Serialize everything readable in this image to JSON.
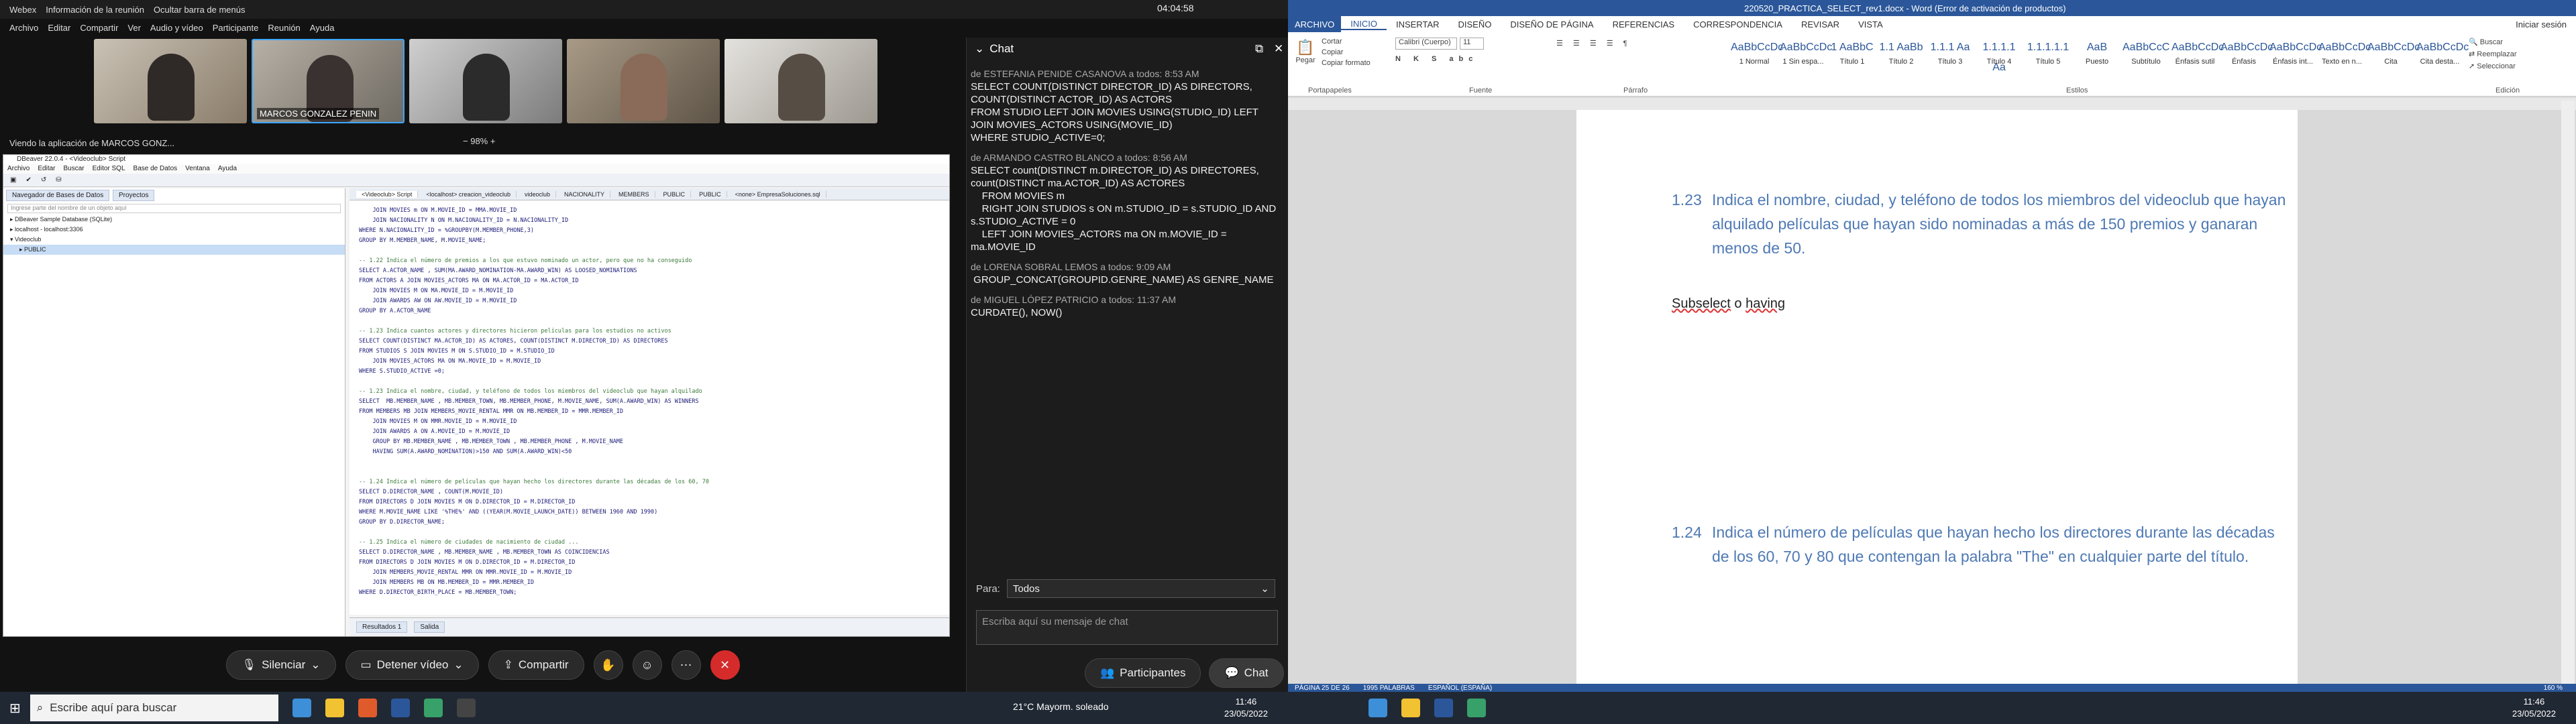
{
  "webex": {
    "app_name": "Webex",
    "meeting_info": "Información de la reunión",
    "hide_bar": "Ocultar barra de menús",
    "clock": "04:04:58",
    "menu": [
      "Archivo",
      "Editar",
      "Compartir",
      "Ver",
      "Audio y vídeo",
      "Participante",
      "Reunión",
      "Ayuda"
    ],
    "video_tiles": [
      {
        "name": ""
      },
      {
        "name": "MARCOS GONZALEZ PENIN"
      },
      {
        "name": ""
      },
      {
        "name": ""
      },
      {
        "name": ""
      }
    ],
    "viewing": "Viendo la aplicación de MARCOS GONZ...",
    "zoom": "98%",
    "controls": {
      "mute": "Silenciar",
      "stop_video": "Detener vídeo",
      "share": "Compartir",
      "participants": "Participantes",
      "chat": "Chat"
    }
  },
  "dbeaver": {
    "title": "DBeaver 22.0.4 - <Videoclub> Script",
    "menu": [
      "Archivo",
      "Editar",
      "Buscar",
      "Editor SQL",
      "Base de Datos",
      "Ventana",
      "Ayuda"
    ],
    "nav_tabs": [
      "Navegador de Bases de Datos",
      "Proyectos"
    ],
    "nav_filter": "Ingrese parte del nombre de un objeto aquí",
    "tree": [
      "DBeaver Sample Database (SQLite)",
      "localhost - localhost:3306",
      "Videoclub",
      "PUBLIC"
    ],
    "editor_tabs": [
      "<Videoclub> Script",
      "<localhost> creacion_videoclub",
      "videoclub",
      "NACIONALITY",
      "MEMBERS",
      "PUBLIC",
      "PUBLIC",
      "<none> EmpresaSoluciones.sql"
    ],
    "bottom_tabs": [
      "Resultados 1",
      "Salida"
    ],
    "code_lines": [
      "    JOIN MOVIES m ON M.MOVIE_ID = MMA.MOVIE_ID",
      "    JOIN NACIONALITY N ON M.NACIONALITY_ID = N.NACIONALITY_ID",
      "WHERE N.NACIONALITY_ID = %GROUPBY(M.MEMBER_PHONE,3)",
      "GROUP BY M.MEMBER_NAME, M.MOVIE_NAME;",
      "",
      "-- 1.22 Indica el número de premios a los que estuvo nominado un actor, pero que no ha conseguido",
      "SELECT A.ACTOR_NAME , SUM(MA.AWARD_NOMINATION-MA.AWARD_WIN) AS LOOSED_NOMINATIONS",
      "FROM ACTORS A JOIN MOVIES_ACTORS MA ON MA.ACTOR_ID = MA.ACTOR_ID",
      "    JOIN MOVIES M ON MA.MOVIE_ID = M.MOVIE_ID",
      "    JOIN AWARDS AW ON AW.MOVIE_ID = M.MOVIE_ID",
      "GROUP BY A.ACTOR_NAME",
      "",
      "-- 1.23 Indica cuantos actores y directores hicieron películas para los estudios no activos",
      "SELECT COUNT(DISTINCT MA.ACTOR_ID) AS ACTORES, COUNT(DISTINCT M.DIRECTOR_ID) AS DIRECTORES",
      "FROM STUDIOS S JOIN MOVIES M ON S.STUDIO_ID = M.STUDIO_ID",
      "    JOIN MOVIES_ACTORS MA ON MA.MOVIE_ID = M.MOVIE_ID",
      "WHERE S.STUDIO_ACTIVE =0;",
      "",
      "-- 1.23 Indica el nombre, ciudad, y teléfono de todos los miembros del videoclub que hayan alquilado",
      "SELECT  MB.MEMBER_NAME , MB.MEMBER_TOWN, MB.MEMBER_PHONE, M.MOVIE_NAME, SUM(A.AWARD_WIN) AS WINNERS",
      "FROM MEMBERS MB JOIN MEMBERS_MOVIE_RENTAL MMR ON MB.MEMBER_ID = MMR.MEMBER_ID",
      "    JOIN MOVIES M ON MMR.MOVIE_ID = M.MOVIE_ID",
      "    JOIN AWARDS A ON A.MOVIE_ID = M.MOVIE_ID",
      "    GROUP BY MB.MEMBER_NAME , MB.MEMBER_TOWN , MB.MEMBER_PHONE , M.MOVIE_NAME",
      "    HAVING SUM(A.AWARD_NOMINATION)>150 AND SUM(A.AWARD_WIN)<50",
      "",
      "",
      "-- 1.24 Indica el número de películas que hayan hecho los directores durante las décadas de los 60, 70",
      "SELECT D.DIRECTOR_NAME , COUNT(M.MOVIE_ID)",
      "FROM DIRECTORS D JOIN MOVIES M ON D.DIRECTOR_ID = M.DIRECTOR_ID",
      "WHERE M.MOVIE_NAME LIKE '%THE%' AND ((YEAR(M.MOVIE_LAUNCH_DATE)) BETWEEN 1960 AND 1990)",
      "GROUP BY D.DIRECTOR_NAME;",
      "",
      "-- 1.25 Indica el número de ciudades de nacimiento de ciudad ...",
      "SELECT D.DIRECTOR_NAME , MB.MEMBER_NAME , MB.MEMBER_TOWN AS COINCIDENCIAS",
      "FROM DIRECTORS D JOIN MOVIES M ON D.DIRECTOR_ID = M.DIRECTOR_ID",
      "    JOIN MEMBERS_MOVIE_RENTAL MMR ON MMR.MOVIE_ID = M.MOVIE_ID",
      "    JOIN MEMBERS MB ON MB.MEMBER_ID = MMR.MEMBER_ID",
      "WHERE D.DIRECTOR_BIRTH_PLACE = MB.MEMBER_TOWN;"
    ]
  },
  "chat": {
    "title": "Chat",
    "messages": [
      {
        "from": "de ESTEFANIA PENIDE CASANOVA a todos:    8:53 AM",
        "body": "SELECT COUNT(DISTINCT DIRECTOR_ID) AS DIRECTORS, COUNT(DISTINCT ACTOR_ID) AS ACTORS\nFROM STUDIO LEFT JOIN MOVIES USING(STUDIO_ID) LEFT JOIN MOVIES_ACTORS USING(MOVIE_ID)\nWHERE STUDIO_ACTIVE=0;"
      },
      {
        "from": "de ARMANDO CASTRO BLANCO a todos:    8:56 AM",
        "body": "SELECT count(DISTINCT m.DIRECTOR_ID) AS DIRECTORES, count(DISTINCT ma.ACTOR_ID) AS ACTORES\n    FROM MOVIES m\n    RIGHT JOIN STUDIOS s ON m.STUDIO_ID = s.STUDIO_ID AND s.STUDIO_ACTIVE = 0\n    LEFT JOIN MOVIES_ACTORS ma ON m.MOVIE_ID = ma.MOVIE_ID"
      },
      {
        "from": "de LORENA SOBRAL LEMOS a todos:    9:09 AM",
        "body": " GROUP_CONCAT(GROUPID.GENRE_NAME) AS GENRE_NAME"
      },
      {
        "from": "de MIGUEL LÓPEZ PATRICIO a todos:    11:37 AM",
        "body": "CURDATE(), NOW()"
      }
    ],
    "to_label": "Para:",
    "to_value": "Todos",
    "input_placeholder": "Escriba aquí su mensaje de chat"
  },
  "word": {
    "title": "220520_PRACTICA_SELECT_rev1.docx - Word (Error de activación de productos)",
    "user": "Iniciar sesión",
    "tabs": [
      "ARCHIVO",
      "INICIO",
      "INSERTAR",
      "DISEÑO",
      "DISEÑO DE PÁGINA",
      "REFERENCIAS",
      "CORRESPONDENCIA",
      "REVISAR",
      "VISTA"
    ],
    "clipboard": {
      "paste": "Pegar",
      "cut": "Cortar",
      "copy": "Copiar",
      "format": "Copiar formato",
      "group": "Portapapeles"
    },
    "font": {
      "name": "Calibri (Cuerpo)",
      "size": "11",
      "group": "Fuente"
    },
    "paragraph_group": "Párrafo",
    "styles": [
      {
        "preview": "AaBbCcDc",
        "name": "1 Normal"
      },
      {
        "preview": "AaBbCcDc",
        "name": "1 Sin espa..."
      },
      {
        "preview": "1 AaBbC",
        "name": "Título 1"
      },
      {
        "preview": "1.1 AaBb",
        "name": "Título 2"
      },
      {
        "preview": "1.1.1 Aa",
        "name": "Título 3"
      },
      {
        "preview": "1.1.1.1 Aa",
        "name": "Título 4"
      },
      {
        "preview": "1.1.1.1.1",
        "name": "Título 5"
      },
      {
        "preview": "AaB",
        "name": "Puesto"
      },
      {
        "preview": "AaBbCcC",
        "name": "Subtítulo"
      },
      {
        "preview": "AaBbCcDc",
        "name": "Énfasis sutil"
      },
      {
        "preview": "AaBbCcDc",
        "name": "Énfasis"
      },
      {
        "preview": "AaBbCcDc",
        "name": "Énfasis int..."
      },
      {
        "preview": "AaBbCcDc",
        "name": "Texto en n..."
      },
      {
        "preview": "AaBbCcDc",
        "name": "Cita"
      },
      {
        "preview": "AaBbCcDc",
        "name": "Cita desta..."
      }
    ],
    "styles_group": "Estilos",
    "editing": {
      "find": "Buscar",
      "replace": "Reemplazar",
      "select": "Seleccionar",
      "group": "Edición"
    },
    "q1_num": "1.23",
    "q1_text": "Indica el nombre, ciudad, y teléfono de todos los miembros del videoclub que hayan alquilado películas que hayan sido nominadas a más de 150 premios y ganaran menos de 50.",
    "note_a": "Subselect",
    "note_b": "o",
    "note_c": "having",
    "q2_num": "1.24",
    "q2_text": "Indica el número de películas que hayan hecho los directores durante las décadas de los 60, 70 y 80 que contengan la palabra \"The\" en cualquier parte del título.",
    "status": {
      "page": "PÁGINA 25 DE 26",
      "words": "1995 PALABRAS",
      "lang": "ESPAÑOL (ESPAÑA)",
      "zoom": "160 %"
    }
  },
  "taskbar": {
    "search": "Escribe aquí para buscar",
    "weather": "21°C  Mayorm. soleado",
    "time_left": "11:46",
    "date_left": "23/05/2022",
    "time_right": "11:46",
    "date_right": "23/05/2022"
  }
}
